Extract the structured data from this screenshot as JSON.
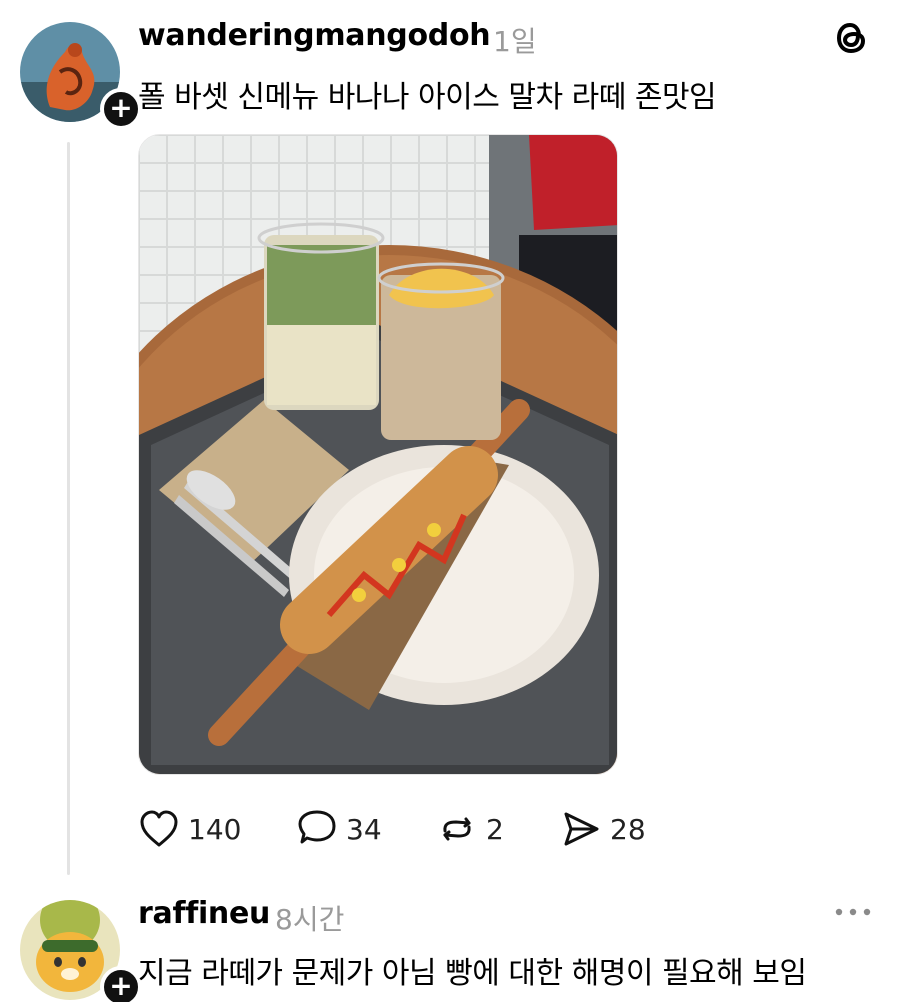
{
  "post": {
    "username": "wanderingmangodoh",
    "time": "1일",
    "text": "폴 바셋 신메뉴 바나나 아이스 말차 라떼 존맛임",
    "follow_symbol": "+",
    "avatar_icon": "orange-figure-avatar",
    "photo_icon": "food-tray-photo",
    "actions": {
      "likes": "140",
      "replies": "34",
      "reposts": "2",
      "shares": "28"
    }
  },
  "reply": {
    "username": "raffineu",
    "time": "8시간",
    "text": "지금 라떼가 문제가 아님 빵에 대한 해명이 필요해 보임",
    "follow_symbol": "+",
    "avatar_icon": "cartoon-lion-avatar"
  },
  "colors": {
    "accent": "#000000",
    "muted": "#9a9a9a",
    "line": "#e3e3e3"
  }
}
